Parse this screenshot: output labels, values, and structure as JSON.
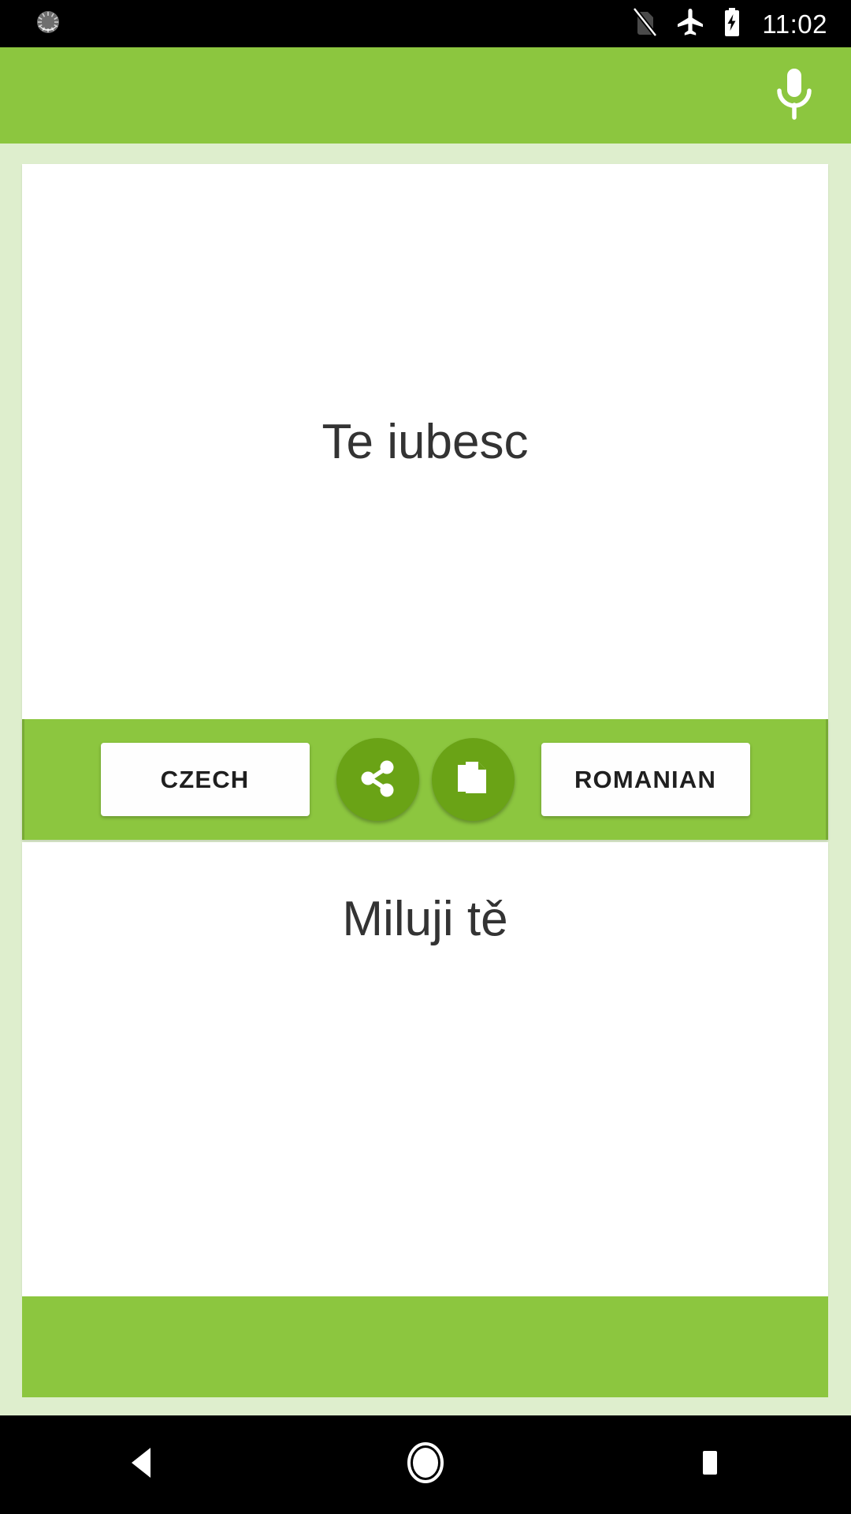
{
  "status_bar": {
    "notification_icon": "sync-notification-icon",
    "no_sim_icon": "no-sim-icon",
    "airplane_icon": "airplane-mode-icon",
    "battery_icon": "battery-charging-icon",
    "time": "11:02"
  },
  "app_bar": {
    "mic_icon": "microphone-icon",
    "background_color": "#8cc63f"
  },
  "source_panel": {
    "text": "Te iubesc"
  },
  "action_bar": {
    "source_language_label": "CZECH",
    "target_language_label": "ROMANIAN",
    "share_icon": "share-icon",
    "copy_icon": "copy-icon",
    "fab_color": "#6aa316"
  },
  "target_panel": {
    "text": "Miluji tě"
  },
  "bottom_banner": {
    "label": ""
  },
  "nav_bar": {
    "back_icon": "back-triangle-icon",
    "home_icon": "home-circle-icon",
    "recents_icon": "recents-square-icon"
  },
  "colors": {
    "primary_green": "#8cc63f",
    "light_green_bg": "#deeecd",
    "dark_green": "#6aa316",
    "text_dark": "#333333"
  }
}
